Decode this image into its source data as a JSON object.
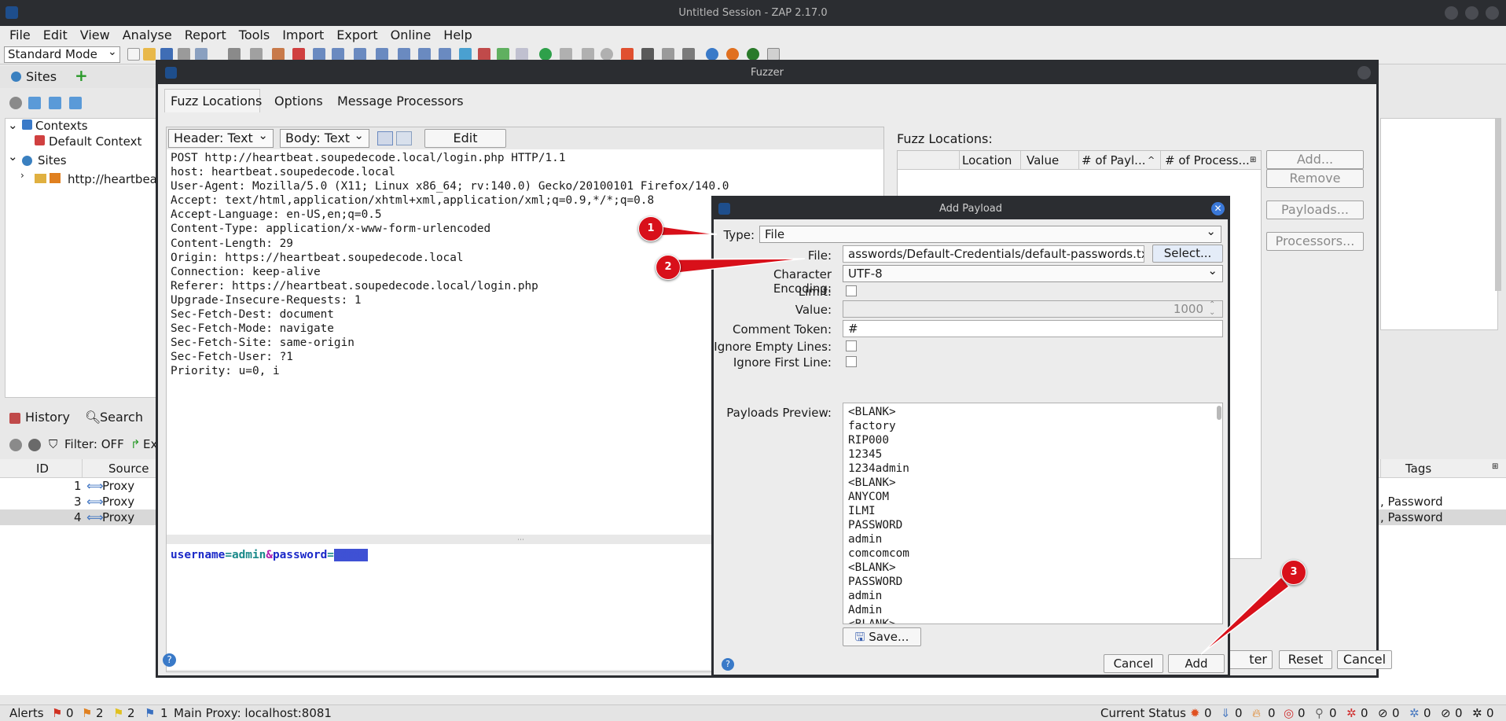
{
  "window_title": "Untitled Session - ZAP 2.17.0",
  "menu": [
    "File",
    "Edit",
    "View",
    "Analyse",
    "Report",
    "Tools",
    "Import",
    "Export",
    "Online",
    "Help"
  ],
  "mode_select": "Standard Mode",
  "sites": {
    "tab": "Sites",
    "tree": [
      "Contexts",
      "Default Context",
      "Sites",
      "http://heartbea"
    ]
  },
  "history": {
    "tabs": [
      "History",
      "Search"
    ],
    "filter": "Filter: OFF",
    "export_label": "Ex",
    "columns": {
      "id": "ID",
      "source": "Source",
      "tags": "Tags"
    },
    "rows": [
      {
        "id": "1",
        "source": "Proxy",
        "tags": ""
      },
      {
        "id": "3",
        "source": "Proxy",
        "tags": ", Password"
      },
      {
        "id": "4",
        "source": "Proxy",
        "tags": ", Password"
      }
    ]
  },
  "status_bar": {
    "alerts": "Alerts",
    "alert_counts": [
      "0",
      "2",
      "2",
      "1"
    ],
    "proxy": "Main Proxy: localhost:8081",
    "current_status": "Current Status",
    "status_counts": [
      "0",
      "0",
      "0",
      "0",
      "0",
      "0",
      "0",
      "0",
      "0",
      "0"
    ]
  },
  "fuzzer": {
    "title": "Fuzzer",
    "tabs": [
      "Fuzz Locations",
      "Options",
      "Message Processors"
    ],
    "header_view": "Header: Text",
    "body_view": "Body: Text",
    "edit_button": "Edit",
    "request_lines": [
      "POST http://heartbeat.soupedecode.local/login.php HTTP/1.1",
      "host: heartbeat.soupedecode.local",
      "User-Agent: Mozilla/5.0 (X11; Linux x86_64; rv:140.0) Gecko/20100101 Firefox/140.0",
      "Accept: text/html,application/xhtml+xml,application/xml;q=0.9,*/*;q=0.8",
      "Accept-Language: en-US,en;q=0.5",
      "Content-Type: application/x-www-form-urlencoded",
      "Content-Length: 29",
      "Origin: https://heartbeat.soupedecode.local",
      "Connection: keep-alive",
      "Referer: https://heartbeat.soupedecode.local/login.php",
      "Upgrade-Insecure-Requests: 1",
      "Sec-Fetch-Dest: document",
      "Sec-Fetch-Mode: navigate",
      "Sec-Fetch-Site: same-origin",
      "Sec-Fetch-User: ?1",
      "Priority: u=0, i"
    ],
    "body": {
      "key1": "username",
      "eq1": "=",
      "val1": "admin",
      "amp": "&",
      "key2": "password",
      "eq2": "=",
      "selected": "admin"
    },
    "fuzz_locations_label": "Fuzz Locations:",
    "location_columns": [
      "Location",
      "Value",
      "# of Payl...",
      "# of Process..."
    ],
    "side_buttons": [
      "Add...",
      "Remove",
      "Payloads...",
      "Processors..."
    ],
    "bottom_buttons": [
      "ter",
      "Reset",
      "Cancel"
    ]
  },
  "add_payload": {
    "title": "Add Payload",
    "type_label": "Type:",
    "type_value": "File",
    "file_label": "File:",
    "file_value": "asswords/Default-Credentials/default-passwords.txt",
    "select_button": "Select...",
    "encoding_label": "Character Encoding:",
    "encoding_value": "UTF-8",
    "limit_label": "Limit:",
    "value_label": "Value:",
    "value_value": "1000",
    "comment_label": "Comment Token:",
    "comment_value": "#",
    "ignore_empty_label": "Ignore Empty Lines:",
    "ignore_first_label": "Ignore First Line:",
    "preview_label": "Payloads Preview:",
    "preview": [
      "<BLANK>",
      "factory",
      "RIP000",
      "12345",
      "1234admin",
      "<BLANK>",
      "ANYCOM",
      "ILMI",
      "PASSWORD",
      "admin",
      "comcomcom",
      "<BLANK>",
      "PASSWORD",
      "admin",
      "Admin",
      "<BLANK>"
    ],
    "save_button": "Save...",
    "cancel_button": "Cancel",
    "add_button": "Add"
  },
  "annotations": [
    "1",
    "2",
    "3"
  ],
  "colors": {
    "annotation": "#d8101a",
    "title_bar": "#2b2d31",
    "selection": "#3f51d4"
  }
}
